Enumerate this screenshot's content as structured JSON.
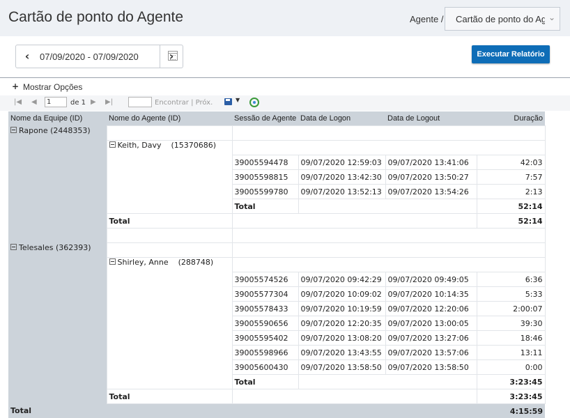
{
  "header": {
    "title": "Cartão de ponto do Agente",
    "breadcrumb": "Agente /",
    "agent_dropdown": "Cartão de ponto do Agente"
  },
  "toolbar": {
    "date_range": "07/09/2020 - 07/09/2020",
    "run_button": "Executar Relatório"
  },
  "options": {
    "label": "Mostrar Opções"
  },
  "pager": {
    "page": "1",
    "of_label": "de 1",
    "find_label": "Encontrar",
    "next_label": "Próx."
  },
  "report": {
    "columns": [
      "Nome da Equipe (ID)",
      "Nome do Agente (ID)",
      "Sessão de Agente",
      "Data de Logon",
      "Data de Logout",
      "Duração"
    ],
    "total_label": "Total",
    "teams": [
      {
        "name": "Rapone",
        "id": "(2448353)",
        "agent": {
          "name": "Keith, Davy",
          "id": "(15370686)"
        },
        "sessions": [
          [
            "39005594478",
            "09/07/2020 12:59:03",
            "09/07/2020 13:41:06",
            "42:03"
          ],
          [
            "39005598815",
            "09/07/2020 13:42:30",
            "09/07/2020 13:50:27",
            "7:57"
          ],
          [
            "39005599780",
            "09/07/2020 13:52:13",
            "09/07/2020 13:54:26",
            "2:13"
          ]
        ],
        "agent_total": "52:14",
        "team_total": "52:14"
      },
      {
        "name": "Telesales",
        "id": "(362393)",
        "agent": {
          "name": "Shirley, Anne",
          "id": "(288748)"
        },
        "sessions": [
          [
            "39005574526",
            "09/07/2020 09:42:29",
            "09/07/2020 09:49:05",
            "6:36"
          ],
          [
            "39005577304",
            "09/07/2020 10:09:02",
            "09/07/2020 10:14:35",
            "5:33"
          ],
          [
            "39005578433",
            "09/07/2020 10:19:59",
            "09/07/2020 12:20:06",
            "2:00:07"
          ],
          [
            "39005590656",
            "09/07/2020 12:20:35",
            "09/07/2020 13:00:05",
            "39:30"
          ],
          [
            "39005595402",
            "09/07/2020 13:08:20",
            "09/07/2020 13:27:06",
            "18:46"
          ],
          [
            "39005598966",
            "09/07/2020 13:43:55",
            "09/07/2020 13:57:06",
            "13:11"
          ],
          [
            "39005600430",
            "09/07/2020 13:58:50",
            "09/07/2020 13:58:50",
            "0:00"
          ]
        ],
        "agent_total": "3:23:45",
        "team_total": "3:23:45"
      }
    ],
    "grand_total": "4:15:59"
  }
}
